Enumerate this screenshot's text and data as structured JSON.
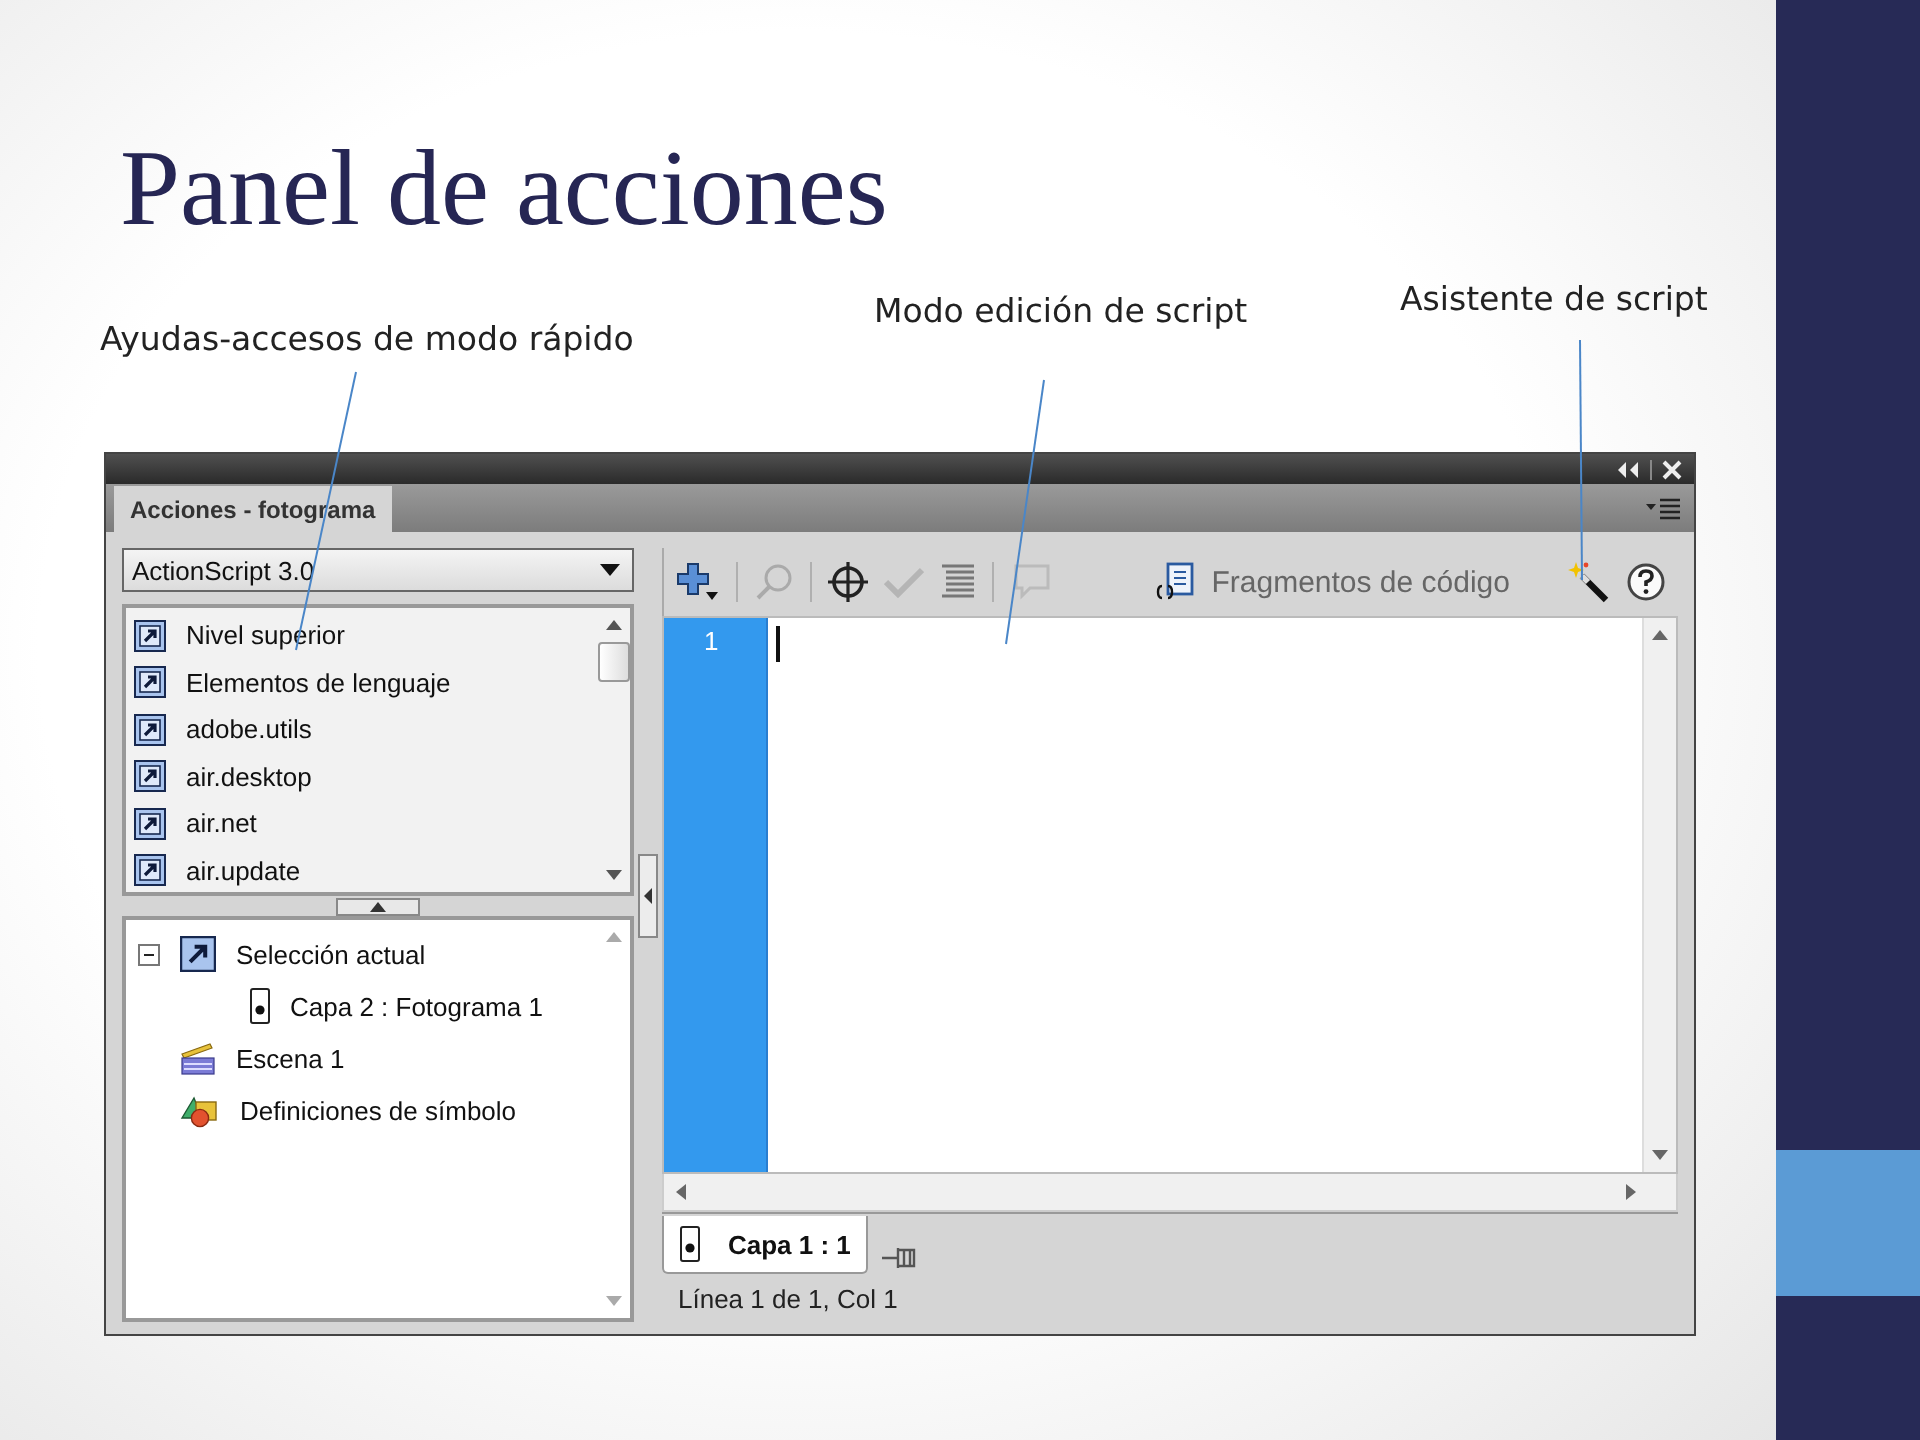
{
  "slide": {
    "title": "Panel de acciones",
    "annotations": [
      {
        "text": "Ayudas-accesos de modo rápido"
      },
      {
        "text": "Modo edición de script"
      },
      {
        "text": "Asistente de script"
      }
    ]
  },
  "panel": {
    "tab": {
      "label": "Acciones - fotograma",
      "selected": true
    },
    "language_select": {
      "value": "ActionScript 3.0"
    },
    "library_items": [
      {
        "label": "Nivel superior"
      },
      {
        "label": "Elementos de lenguaje"
      },
      {
        "label": "adobe.utils"
      },
      {
        "label": "air.desktop"
      },
      {
        "label": "air.net"
      },
      {
        "label": "air.update"
      }
    ],
    "tree": [
      {
        "label": "Selección actual",
        "kind": "selection",
        "expanded": true,
        "children": [
          {
            "label": "Capa 2 : Fotograma 1",
            "kind": "frame"
          }
        ]
      },
      {
        "label": "Escena 1",
        "kind": "scene"
      },
      {
        "label": "Definiciones de símbolo",
        "kind": "symbols"
      }
    ],
    "toolbar": {
      "snippets_label": "Fragmentos de código"
    },
    "editor": {
      "line_numbers": [
        "1"
      ]
    },
    "layer_tab": {
      "label": "Capa 1 : 1",
      "selected": true
    },
    "status": "Línea 1 de 1, Col 1"
  }
}
